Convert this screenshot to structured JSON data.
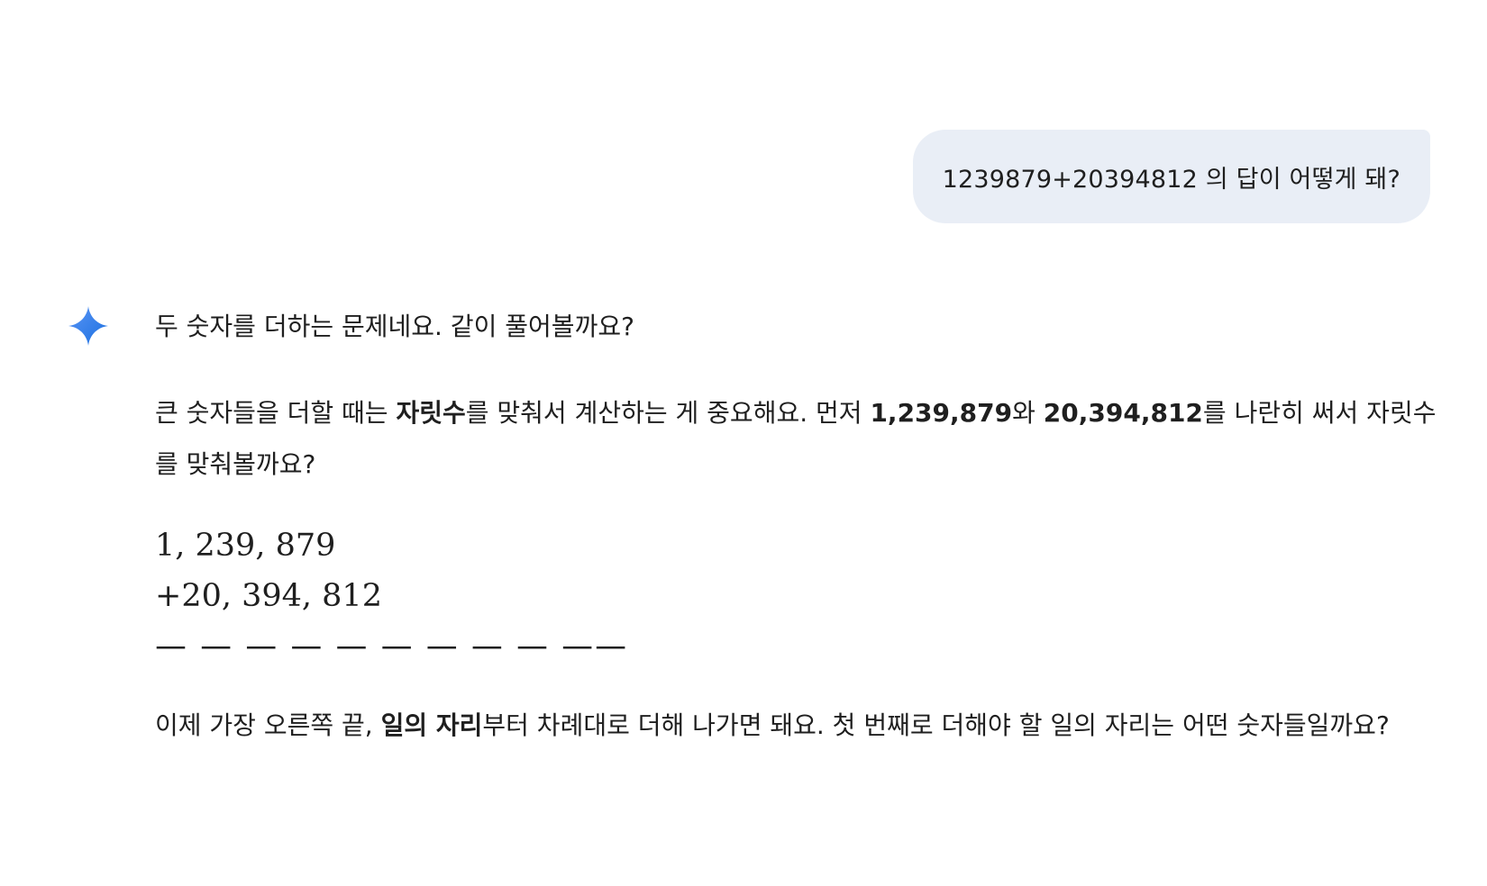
{
  "user_message": {
    "text": "1239879+20394812 의 답이 어떻게 돼?"
  },
  "assistant": {
    "icon": "gemini-sparkle-icon",
    "intro": "두 숫자를 더하는 문제네요. 같이 풀어볼까요?",
    "align_paragraph": {
      "part1": "큰 숫자들을 더할 때는 ",
      "bold1": "자릿수",
      "part2": "를 맞춰서 계산하는 게 중요해요. 먼저 ",
      "bold2": "1,239,879",
      "part3": "와 ",
      "bold3": "20,394,812",
      "part4": "를 나란히 써서 자릿수를 맞춰볼까요?"
    },
    "math": {
      "line1": "1, 239, 879",
      "line2": "+20, 394, 812",
      "rule": "— — — — — — — — — ——"
    },
    "next_paragraph": {
      "part1": "이제 가장 오른쪽 끝, ",
      "bold1": "일의 자리",
      "part2": "부터 차례대로 더해 나가면 돼요. 첫 번째로 더해야 할 일의 자리는 어떤 숫자들일까요?"
    }
  },
  "colors": {
    "user_bubble_bg": "#e9eef6",
    "text": "#1f1f1f",
    "sparkle_start": "#4285f4",
    "sparkle_end": "#1a73e8"
  }
}
